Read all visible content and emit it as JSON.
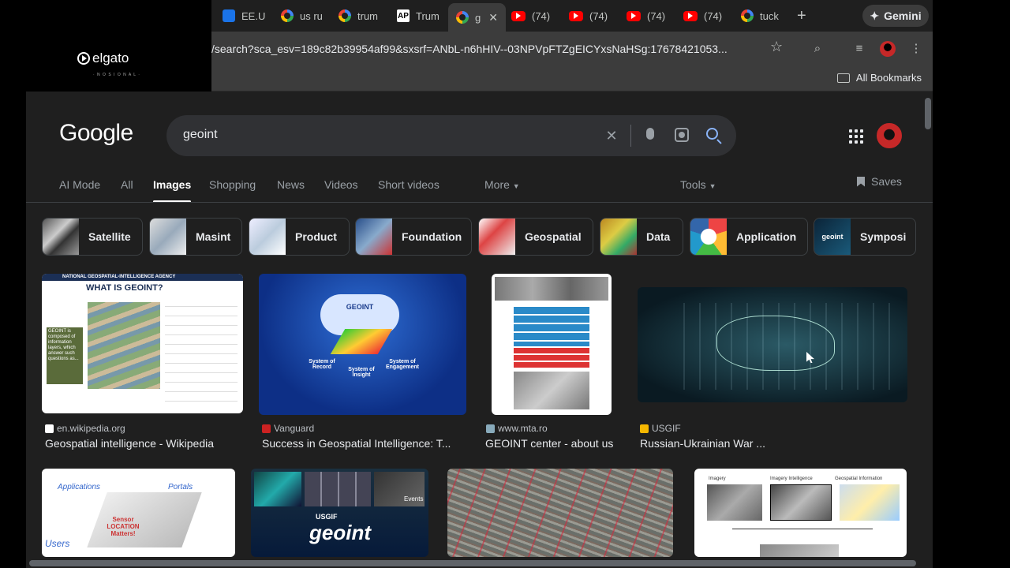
{
  "overlay": {
    "logo_text": "elgato",
    "logo_sub": "· N O S I O N A L ·"
  },
  "browser": {
    "tabs": [
      {
        "label": "EE.U",
        "icon": "ee-favicon"
      },
      {
        "label": "us ru",
        "icon": "google-favicon"
      },
      {
        "label": "trum",
        "icon": "google-favicon"
      },
      {
        "label": "Trum",
        "icon": "ap-favicon"
      },
      {
        "label": "g",
        "icon": "google-favicon",
        "active": true
      },
      {
        "label": "(74)",
        "icon": "youtube-favicon"
      },
      {
        "label": "(74)",
        "icon": "youtube-favicon"
      },
      {
        "label": "(74)",
        "icon": "youtube-favicon"
      },
      {
        "label": "(74)",
        "icon": "youtube-favicon"
      },
      {
        "label": "tuck",
        "icon": "google-favicon"
      }
    ],
    "new_tab": "+",
    "gemini_label": "Gemini",
    "url": "/search?sca_esv=189c82b39954af99&sxsrf=ANbL-n6hHIV--03NPVpFTZgEICYxsNaHSg:17678421053...",
    "all_bookmarks": "All Bookmarks"
  },
  "google": {
    "logo": "Google",
    "query": "geoint",
    "tabs": [
      "AI Mode",
      "All",
      "Images",
      "Shopping",
      "News",
      "Videos",
      "Short videos",
      "More"
    ],
    "active_tab": "Images",
    "tools": "Tools",
    "saves": "Saves",
    "chips": [
      "Satellite",
      "Masint",
      "Product",
      "Foundation",
      "Geospatial",
      "Data",
      "Application",
      "Symposi"
    ],
    "results": [
      {
        "source": "en.wikipedia.org",
        "title": "Geospatial intelligence - Wikipedia",
        "thumb_heading": "WHAT IS GEOINT?",
        "thumb_banner": "NATIONAL GEOSPATIAL-INTELLIGENCE AGENCY",
        "thumb_box": "GEOINT is composed of information layers, which answer such questions as..."
      },
      {
        "source": "Vanguard",
        "title": "Success in Geospatial Intelligence: T...",
        "thumb_heading": "GEOINT",
        "thumb_labels": [
          "System of Record",
          "System of Insight",
          "System of Engagement"
        ]
      },
      {
        "source": "www.mta.ro",
        "title": "GEOINT center - about us"
      },
      {
        "source": "USGIF",
        "title": "Russian-Ukrainian War ..."
      }
    ],
    "row2": [
      {
        "labels": [
          "Applications",
          "Portals",
          "Sensor LOCATION Matters!",
          "Users"
        ]
      },
      {
        "labels": [
          "Events",
          "USGIF",
          "geoint"
        ]
      },
      {
        "labels": []
      },
      {
        "labels": [
          "Imagery",
          "Imagery Intelligence",
          "Geospatial Information"
        ]
      }
    ]
  },
  "colors": {
    "background": "#1f1f1f",
    "accent": "#8ab4f8",
    "chrome": "#3c3c3c"
  }
}
